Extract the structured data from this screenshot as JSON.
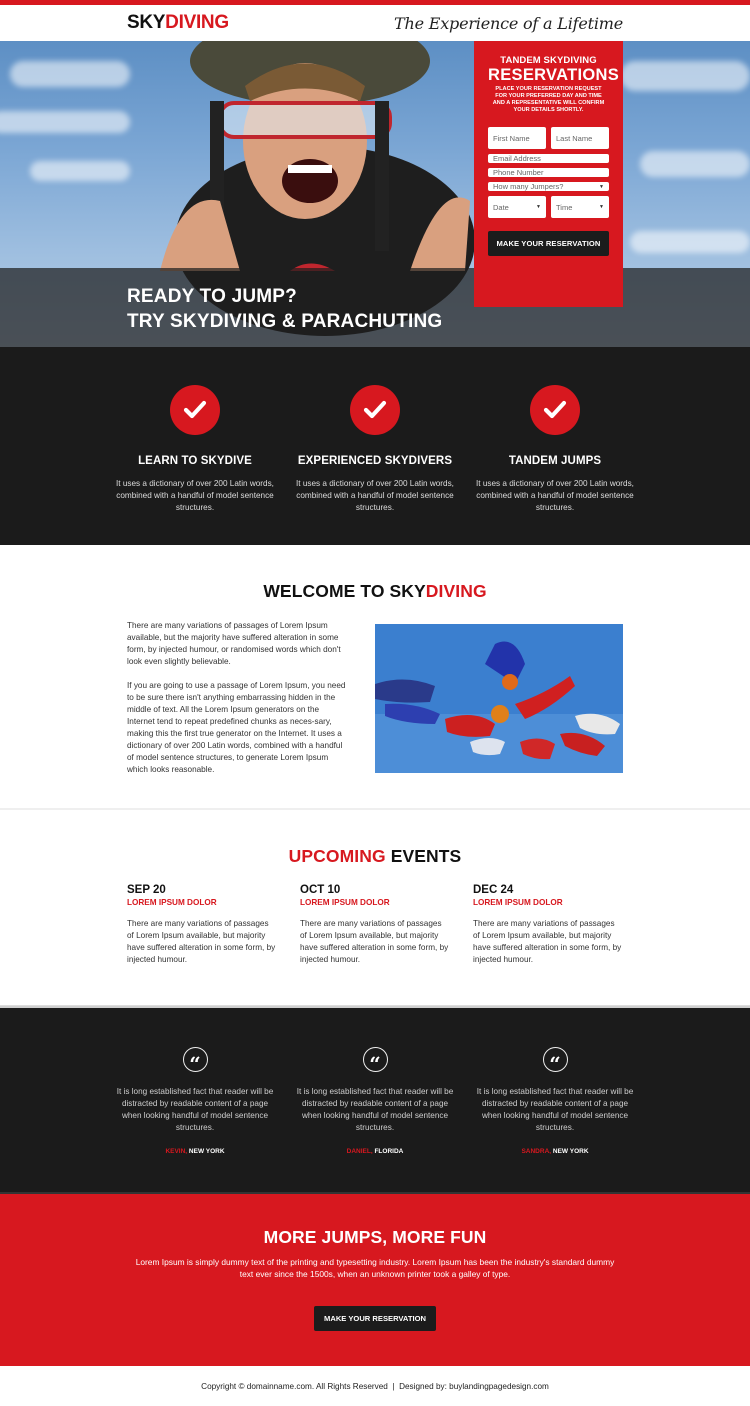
{
  "header": {
    "logo_part1": "SKY",
    "logo_part2": "DIVING",
    "tagline": "The Experience of a Lifetime"
  },
  "hero": {
    "headline_line1": "READY TO JUMP?",
    "headline_line2": "TRY SKYDIVING & PARACHUTING",
    "image_alt": "tandem-skydiver-thumbs-up"
  },
  "reservation_form": {
    "subtitle": "TANDEM SKYDIVING",
    "title": "RESERVATIONS",
    "description": "PLACE YOUR RESERVATION REQUEST FOR YOUR PREFERRED DAY AND TIME AND A REPRESENTATIVE WILL CONFIRM YOUR DETAILS SHORTLY.",
    "fields": {
      "first_name": {
        "placeholder": "First Name",
        "value": ""
      },
      "last_name": {
        "placeholder": "Last Name",
        "value": ""
      },
      "email": {
        "placeholder": "Email Address",
        "value": ""
      },
      "phone": {
        "placeholder": "Phone Number",
        "value": ""
      },
      "jumpers": {
        "selected": "How many Jumpers?"
      },
      "date": {
        "selected": "Date"
      },
      "time": {
        "selected": "Time"
      }
    },
    "submit_label": "MAKE YOUR RESERVATION"
  },
  "features": [
    {
      "icon": "check-icon",
      "title": "LEARN TO SKYDIVE",
      "text": "It uses a dictionary of over 200 Latin words, combined with a handful of model sentence structures."
    },
    {
      "icon": "check-icon",
      "title": "EXPERIENCED SKYDIVERS",
      "text": "It uses a dictionary of over 200 Latin words, combined with a handful of model sentence structures."
    },
    {
      "icon": "check-icon",
      "title": "TANDEM JUMPS",
      "text": "It uses a dictionary of over 200 Latin words, combined with a handful of model sentence structures."
    }
  ],
  "welcome": {
    "title_part1": "WELCOME TO SKY",
    "title_part2": "DIVING",
    "paragraph1": "There are many variations of passages of Lorem Ipsum available, but the majority have suffered alteration in some form, by injected humour, or randomised words which don't look even slightly believable.",
    "paragraph2": "If you are going to use a passage of Lorem Ipsum, you need to be sure there isn't anything embarrassing hidden in the middle of text. All the Lorem Ipsum generators on the Internet tend to repeat predefined chunks as neces-sary, making this the first true generator on the Internet. It uses a dictionary of over 200 Latin words, combined with a handful of model sentence structures, to generate Lorem Ipsum which looks reasonable.",
    "image_alt": "formation-skydiving-group"
  },
  "events": {
    "title_part1": "UPCOMING",
    "title_part2": " EVENTS",
    "items": [
      {
        "date": "SEP 20",
        "name": "LOREM IPSUM DOLOR",
        "text": "There are many variations of passages of Lorem Ipsum available, but majority have suffered alteration in some form, by injected humour."
      },
      {
        "date": "OCT 10",
        "name": "LOREM IPSUM DOLOR",
        "text": "There are many variations of passages of Lorem Ipsum available, but majority have suffered alteration in some form, by injected humour."
      },
      {
        "date": "DEC 24",
        "name": "LOREM IPSUM DOLOR",
        "text": "There are many variations of passages of Lorem Ipsum available, but majority have suffered alteration in some form, by injected humour."
      }
    ]
  },
  "testimonials": [
    {
      "quote_glyph": "“",
      "text": "It is long established fact that  reader will be distracted by readable content of a page when looking handful of model sentence structures.",
      "name": "KEVIN,",
      "location": " NEW YORK"
    },
    {
      "quote_glyph": "“",
      "text": "It is long established fact that  reader will be distracted by readable content of a page when looking handful of model sentence structures.",
      "name": "DANIEL,",
      "location": " FLORIDA"
    },
    {
      "quote_glyph": "“",
      "text": "It is long established fact that  reader will be distracted by readable content of a page when looking handful of model sentence structures.",
      "name": "SANDRA,",
      "location": " NEW YORK"
    }
  ],
  "cta": {
    "title": "MORE JUMPS, MORE FUN",
    "text": "Lorem Ipsum is simply dummy text of the printing and typesetting industry. Lorem Ipsum has been the industry's standard dummy text ever since the 1500s, when an unknown printer took a galley of type.",
    "button_label": "MAKE YOUR RESERVATION"
  },
  "footer": {
    "text": "Copyright © domainname.com. All Rights Reserved  |  Designed by: buylandingpagedesign.com"
  },
  "colors": {
    "brand_red": "#d7181f",
    "dark": "#1b1b1b",
    "button_dark": "#1c1c1c"
  }
}
